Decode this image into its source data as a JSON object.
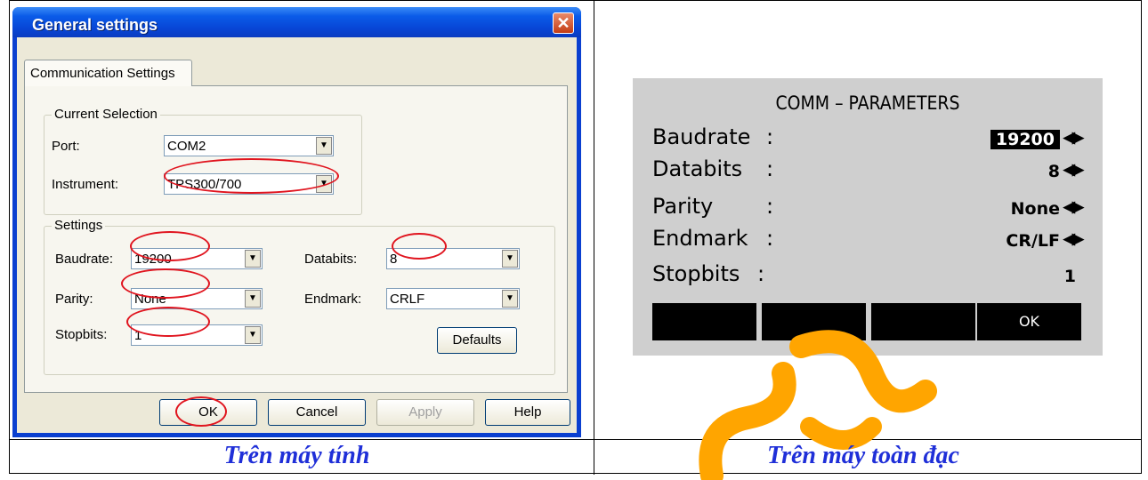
{
  "dialog": {
    "title": "General settings",
    "close_glyph": "✕",
    "tab_label": "Communication Settings",
    "current_selection": {
      "group_label": "Current Selection",
      "port_label": "Port:",
      "port_value": "COM2",
      "instrument_label": "Instrument:",
      "instrument_value": "TPS300/700"
    },
    "settings": {
      "group_label": "Settings",
      "baudrate_label": "Baudrate:",
      "baudrate_value": "19200",
      "databits_label": "Databits:",
      "databits_value": "8",
      "parity_label": "Parity:",
      "parity_value": "None",
      "endmark_label": "Endmark:",
      "endmark_value": "CRLF",
      "stopbits_label": "Stopbits:",
      "stopbits_value": "1",
      "defaults_label": "Defaults"
    },
    "buttons": {
      "ok": "OK",
      "cancel": "Cancel",
      "apply": "Apply",
      "help": "Help"
    }
  },
  "instrument_screen": {
    "title": "COMM – PARAMETERS",
    "rows": [
      {
        "name": "Baudrate",
        "sep": ":",
        "value": "19200"
      },
      {
        "name": "Databits",
        "sep": ":",
        "value": "8"
      },
      {
        "name": "Parity",
        "sep": ":",
        "value": "None"
      },
      {
        "name": "Endmark",
        "sep": ":",
        "value": "CR/LF"
      },
      {
        "name": "Stopbits",
        "sep": ":",
        "value": "1"
      }
    ],
    "softkeys": [
      "",
      "",
      "",
      "OK"
    ]
  },
  "captions": {
    "left": "Trên máy tính",
    "right": "Trên máy toàn đạc"
  },
  "colors": {
    "highlight_ellipse": "#e0141e",
    "caption": "#1f2fd8",
    "titlebar": "#0a5be8",
    "watermark": "#ffa500"
  }
}
